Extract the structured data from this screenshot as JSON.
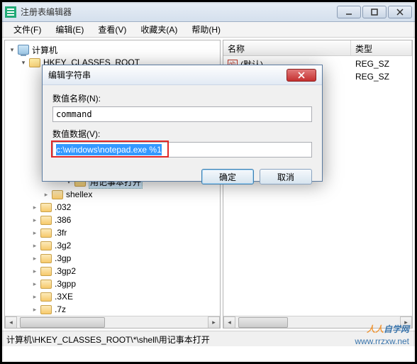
{
  "window": {
    "title": "注册表编辑器"
  },
  "menu": {
    "file": "文件(F)",
    "edit": "编辑(E)",
    "view": "查看(V)",
    "favorites": "收藏夹(A)",
    "help": "帮助(H)"
  },
  "tree": {
    "root": "计算机",
    "hkcr": "HKEY_CLASSES_ROOT",
    "open_with_notepad": "用记事本打开",
    "shellex": "shellex",
    "keys": [
      ".032",
      ".386",
      ".3fr",
      ".3g2",
      ".3gp",
      ".3gp2",
      ".3gpp",
      ".3XE",
      ".7z"
    ]
  },
  "list": {
    "name_header": "名称",
    "type_header": "类型",
    "rows": [
      {
        "name": "(默认)",
        "type": "REG_SZ"
      },
      {
        "name": "",
        "type": "REG_SZ"
      }
    ]
  },
  "dialog": {
    "title": "编辑字符串",
    "name_label": "数值名称(N):",
    "name_value": "command",
    "data_label": "数值数据(V):",
    "data_value": "c:\\windows\\notepad.exe %1",
    "ok": "确定",
    "cancel": "取消"
  },
  "statusbar": {
    "path": "计算机\\HKEY_CLASSES_ROOT\\*\\shell\\用记事本打开"
  },
  "watermark": {
    "brand_prefix": "人人",
    "brand_suffix": "自学网",
    "url": "www.rrzxw.net"
  }
}
